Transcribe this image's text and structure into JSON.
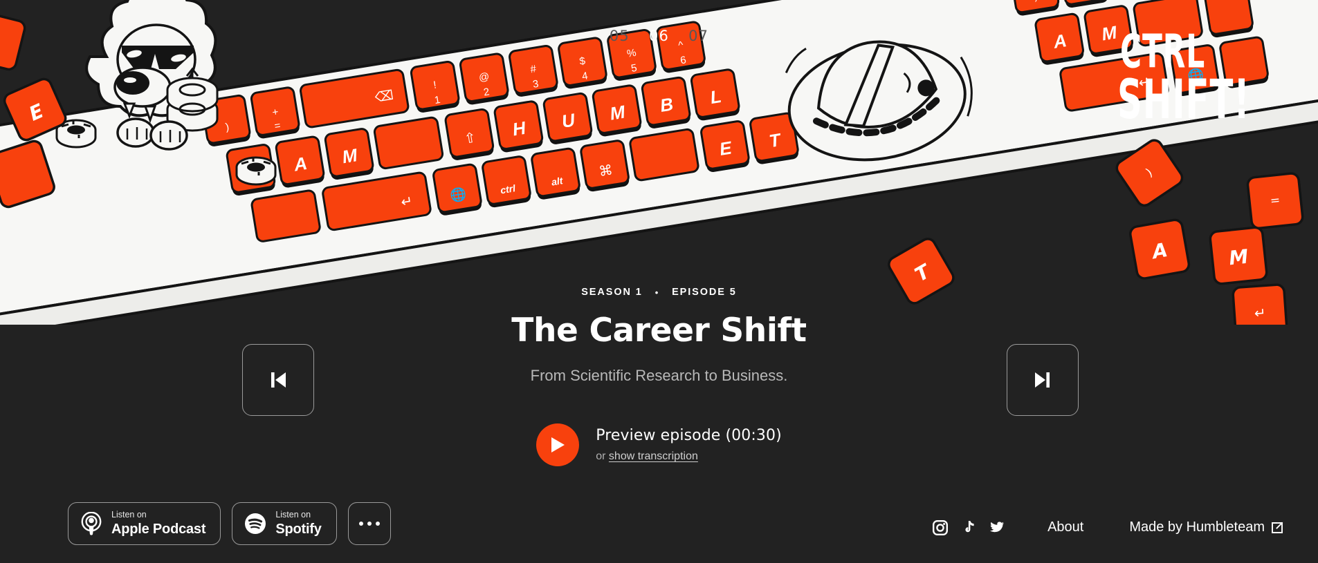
{
  "brand": {
    "logo_line1": "CTRL",
    "logo_line2": "SHIFT!",
    "accent_color": "#F8410D",
    "background_color": "#222222"
  },
  "episode_carousel": {
    "items": [
      {
        "label": "05",
        "state": "dim"
      },
      {
        "label": "06",
        "state": "active"
      },
      {
        "label": "07",
        "state": "dim"
      }
    ]
  },
  "episode": {
    "season_label": "SEASON 1",
    "separator": "•",
    "episode_label": "EPISODE 5",
    "title": "The Career Shift",
    "subtitle": "From Scientific Research to Business."
  },
  "player": {
    "prev_icon": "skip-previous-icon",
    "next_icon": "skip-next-icon",
    "play_icon": "play-icon",
    "preview_label": "Preview episode (00:30)",
    "or_label": "or",
    "transcription_label": "show transcription"
  },
  "listen_buttons": [
    {
      "icon": "apple-podcast-icon",
      "small": "Listen on",
      "big": "Apple Podcast"
    },
    {
      "icon": "spotify-icon",
      "small": "Listen on",
      "big": "Spotify"
    }
  ],
  "more_button": {
    "icon": "ellipsis-icon",
    "label": "..."
  },
  "footer": {
    "socials": [
      {
        "icon": "instagram-icon",
        "name": "Instagram"
      },
      {
        "icon": "tiktok-icon",
        "name": "TikTok"
      },
      {
        "icon": "twitter-icon",
        "name": "Twitter"
      }
    ],
    "about_label": "About",
    "made_by_label": "Made by Humbleteam",
    "external_icon": "external-link-icon"
  },
  "illustration": {
    "description": "Tilted laptop keyboard with orange keys, cartoon dog mascot in sunglasses, and a hat",
    "key_letters": [
      "E",
      "A",
      "M",
      "H",
      "U",
      "M",
      "B",
      "L",
      "E",
      "T",
      "A",
      "M",
      "L",
      "E"
    ],
    "key_symbols": [
      "ctrl",
      "alt",
      "⌘",
      "↵",
      "↑"
    ],
    "key_numbers": [
      "1",
      "2",
      "3",
      "4",
      "5",
      "6"
    ],
    "key_color": "#F8410D",
    "deck_color": "#F7F7F5"
  }
}
